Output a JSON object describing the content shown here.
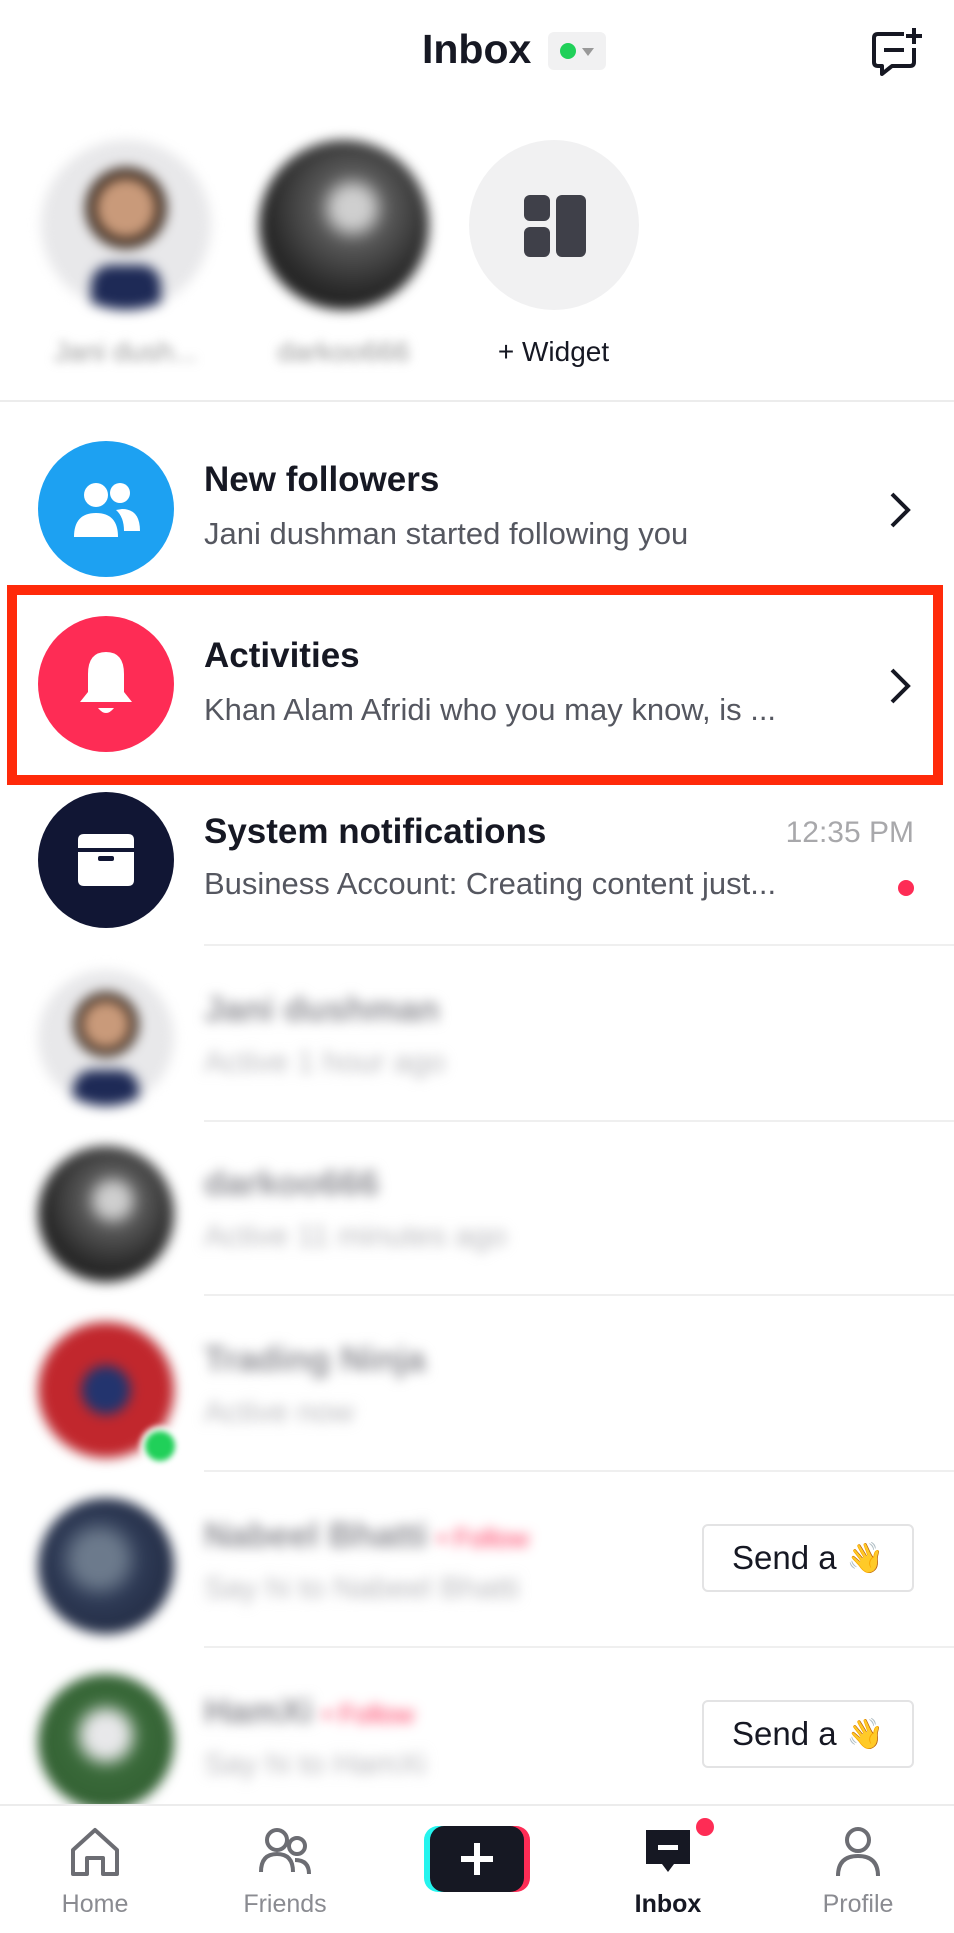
{
  "header": {
    "title": "Inbox",
    "status_color": "#20d059"
  },
  "stories": [
    {
      "label": "Jani dush..."
    },
    {
      "label": "darkoo666"
    },
    {
      "label": "+ Widget",
      "icon": "widget-grid-icon"
    }
  ],
  "notifications": [
    {
      "title": "New followers",
      "subtitle": "Jani dushman started following you",
      "icon": "people-icon",
      "color": "#1da1f2"
    },
    {
      "title": "Activities",
      "subtitle": "Khan Alam Afridi who you may know, is ...",
      "icon": "bell-icon",
      "color": "#fe2c55"
    },
    {
      "title": "System notifications",
      "subtitle": "Business Account: Creating content just...",
      "time": "12:35 PM",
      "icon": "inbox-tray-icon",
      "color": "#111634"
    }
  ],
  "conversations": [
    {
      "name": "Jani dushman",
      "status": "Active 1 hour ago"
    },
    {
      "name": "darkoo666",
      "status": "Active 11 minutes ago"
    },
    {
      "name": "Trading Ninja",
      "status": "Active now"
    },
    {
      "name": "Nabeel Bhatti",
      "follow": "• Follow",
      "status": "Say hi to Nabeel Bhatti",
      "button": "Send a"
    },
    {
      "name": "HamXi",
      "follow": "• Follow",
      "status": "Say hi to HamXi",
      "button": "Send a"
    }
  ],
  "nav": [
    {
      "label": "Home",
      "icon": "home-icon"
    },
    {
      "label": "Friends",
      "icon": "friends-icon"
    },
    {
      "label": "",
      "icon": "plus-icon"
    },
    {
      "label": "Inbox",
      "icon": "inbox-icon",
      "active": true
    },
    {
      "label": "Profile",
      "icon": "profile-icon"
    }
  ],
  "colors": {
    "accent": "#fe2c55",
    "highlight": "#ff2a0a",
    "online": "#20d059"
  }
}
